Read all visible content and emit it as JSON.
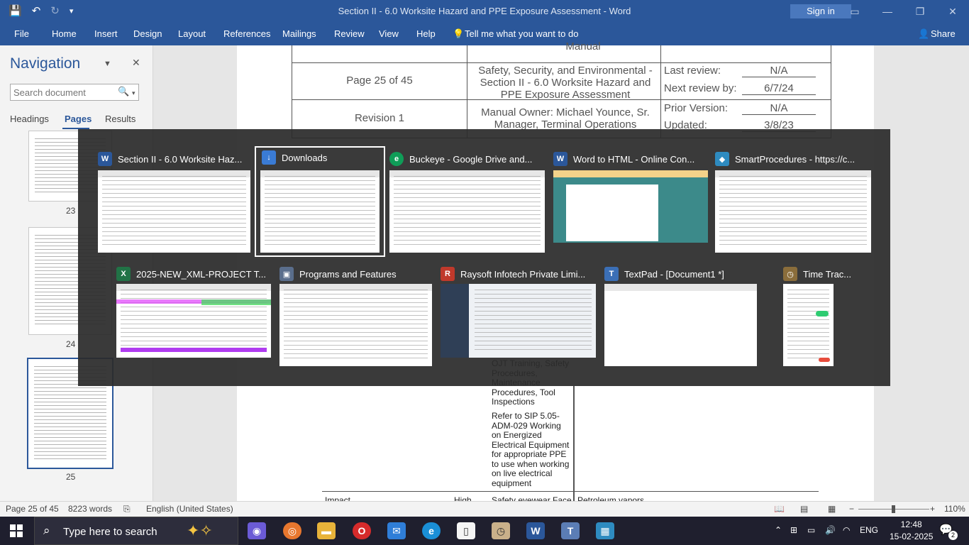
{
  "window": {
    "title": "Section II - 6.0 Worksite Hazard and PPE Exposure Assessment  -  Word",
    "sign_in": "Sign in"
  },
  "ribbon": {
    "tabs": [
      "File",
      "Home",
      "Insert",
      "Design",
      "Layout",
      "References",
      "Mailings",
      "Review",
      "View",
      "Help"
    ],
    "tell_me": "Tell me what you want to do",
    "share": "Share"
  },
  "navigation": {
    "title": "Navigation",
    "search_placeholder": "Search document",
    "tabs": [
      "Headings",
      "Pages",
      "Results"
    ],
    "active_tab": "Pages",
    "page_numbers": [
      "23",
      "24",
      "25"
    ]
  },
  "document": {
    "manual": "Manual",
    "page_info": "Page 25 of 45",
    "revision": "Revision 1",
    "section_title": "Safety, Security, and Environmental - Section II - 6.0 Worksite Hazard and PPE Exposure Assessment",
    "owner": "Manual Owner: Michael Younce, Sr. Manager, Terminal Operations",
    "last_review_label": "Last review:",
    "last_review_value": "N/A",
    "next_review_label": "Next review by:",
    "next_review_value": "6/7/24",
    "prior_version_label": "Prior Version:",
    "prior_version_value": "N/A",
    "updated_label": "Updated:",
    "updated_value": "3/8/23",
    "cell_ojt": "OJT Training, Safety Procedures, Maintenance Procedures, Tool Inspections",
    "cell_refer": "Refer to SIP 5.05-ADM-029 Working on Energized Electrical Equipment for appropriate PPE to use when working on live electrical equipment",
    "row_impact": "Impact",
    "row_high": "High",
    "row_safety": "Safety eyewear Face",
    "row_petroleum": "Petroleum vapors"
  },
  "status_bar": {
    "page": "Page 25 of 45",
    "words": "8223 words",
    "language": "English (United States)",
    "zoom": "110%"
  },
  "alt_tab": {
    "windows": [
      {
        "label": "Section II - 6.0 Worksite Haz...",
        "icon": "word-icon",
        "color": "#2b579a",
        "glyph": "W"
      },
      {
        "label": "Downloads",
        "icon": "download-folder-icon",
        "color": "#3a7bd5",
        "glyph": "↓",
        "selected": true
      },
      {
        "label": "Buckeye - Google Drive and...",
        "icon": "edge-icon",
        "color": "#0f9d58",
        "glyph": "e"
      },
      {
        "label": "Word to HTML - Online Con...",
        "icon": "word-icon",
        "color": "#2b579a",
        "glyph": "W"
      },
      {
        "label": "SmartProcedures - https://c...",
        "icon": "smartprocedures-icon",
        "color": "#2e8bc0",
        "glyph": "◆"
      },
      {
        "label": "2025-NEW_XML-PROJECT T...",
        "icon": "excel-icon",
        "color": "#217346",
        "glyph": "X"
      },
      {
        "label": "Programs and Features",
        "icon": "control-panel-icon",
        "color": "#5a6e8c",
        "glyph": "▣"
      },
      {
        "label": "Raysoft Infotech Private Limi...",
        "icon": "raysoft-icon",
        "color": "#c0392b",
        "glyph": "R"
      },
      {
        "label": "TextPad - [Document1 *]",
        "icon": "textpad-icon",
        "color": "#3b6fb6",
        "glyph": "T"
      },
      {
        "label": "Time Trac...",
        "icon": "time-tracker-icon",
        "color": "#8a6d3b",
        "glyph": "◷"
      }
    ]
  },
  "taskbar": {
    "search_placeholder": "Type here to search",
    "language": "ENG",
    "time": "12:48",
    "date": "15-02-2025",
    "notifications": "2"
  }
}
